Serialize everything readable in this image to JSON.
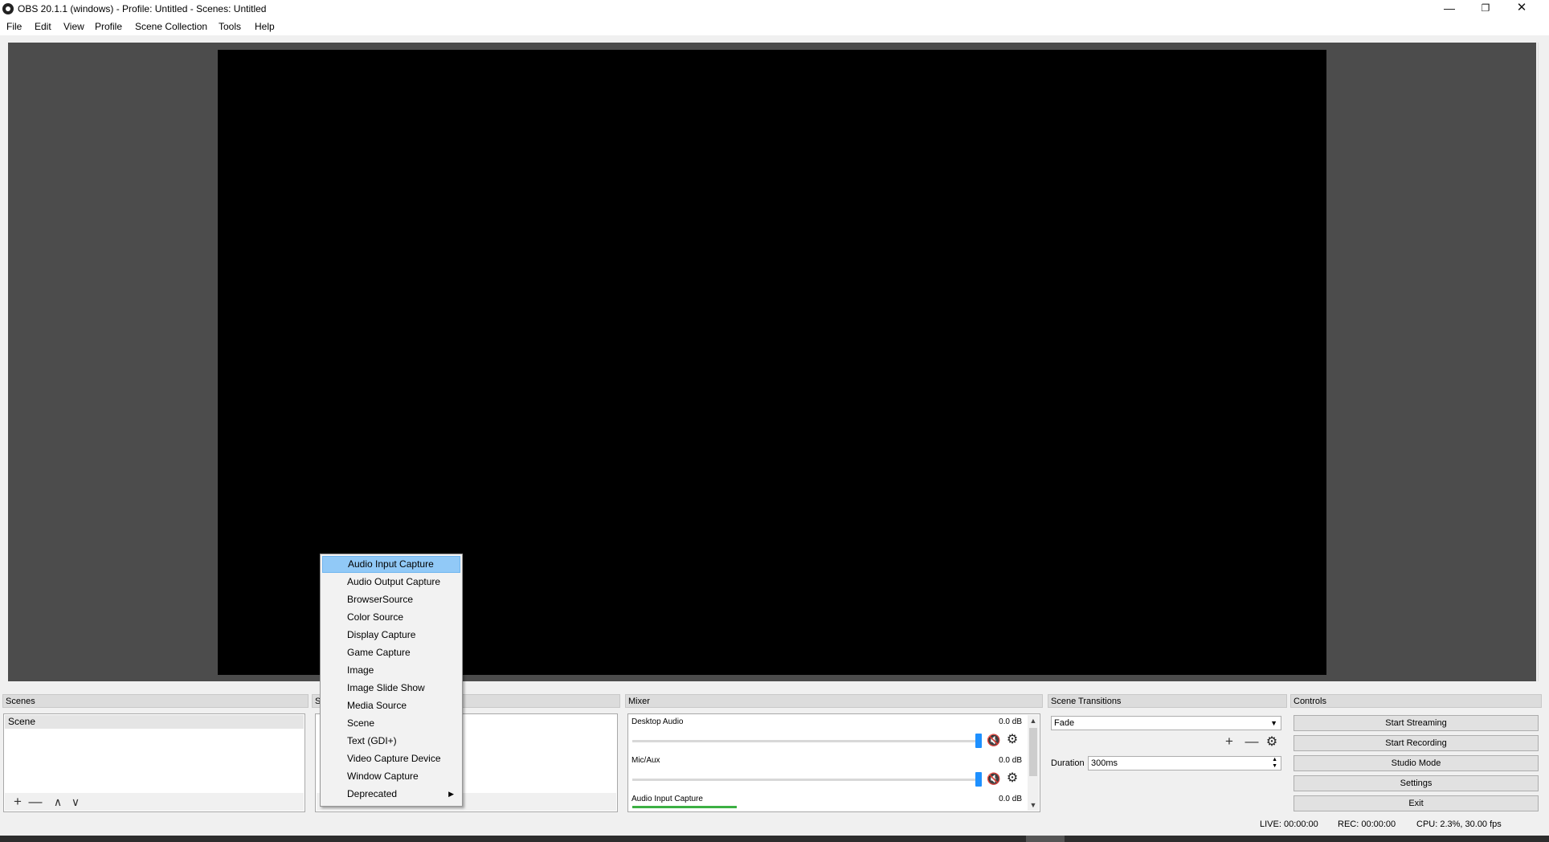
{
  "window": {
    "title": "OBS 20.1.1 (windows) - Profile: Untitled - Scenes: Untitled",
    "minimize": "—",
    "restore": "❐",
    "close": "✕"
  },
  "menu": [
    "File",
    "Edit",
    "View",
    "Profile",
    "Scene Collection",
    "Tools",
    "Help"
  ],
  "docks": {
    "scenes": {
      "title": "Scenes",
      "items": [
        "Scene"
      ]
    },
    "sources": {
      "title": "S"
    },
    "mixer": {
      "title": "Mixer",
      "channels": [
        {
          "name": "Desktop Audio",
          "db": "0.0 dB",
          "level": 1.0
        },
        {
          "name": "Mic/Aux",
          "db": "0.0 dB",
          "level": 1.0
        },
        {
          "name": "Audio Input Capture",
          "db": "0.0 dB",
          "level": 1.0,
          "meter": 0.25
        }
      ]
    },
    "transitions": {
      "title": "Scene Transitions",
      "selected": "Fade",
      "duration_label": "Duration",
      "duration_value": "300ms"
    },
    "controls": {
      "title": "Controls",
      "buttons": [
        "Start Streaming",
        "Start Recording",
        "Studio Mode",
        "Settings",
        "Exit"
      ]
    }
  },
  "context_menu": {
    "items": [
      "Audio Input Capture",
      "Audio Output Capture",
      "BrowserSource",
      "Color Source",
      "Display Capture",
      "Game Capture",
      "Image",
      "Image Slide Show",
      "Media Source",
      "Scene",
      "Text (GDI+)",
      "Video Capture Device",
      "Window Capture",
      "Deprecated"
    ],
    "highlighted": "Audio Input Capture"
  },
  "status": {
    "live": "LIVE: 00:00:00",
    "rec": "REC: 00:00:00",
    "cpu": "CPU: 2.3%, 30.00 fps"
  },
  "icons": {
    "add": "+",
    "remove": "—",
    "up": "∧",
    "down": "∨",
    "gear": "⚙",
    "mute": "🔇"
  },
  "colors": {
    "preview_bg": "#4c4c4c",
    "canvas": "#000000",
    "menu_highlight": "#91c9f7",
    "volume_handle": "#1e90ff",
    "mute_red": "#dd0000",
    "meter_green": "#3cb043"
  }
}
